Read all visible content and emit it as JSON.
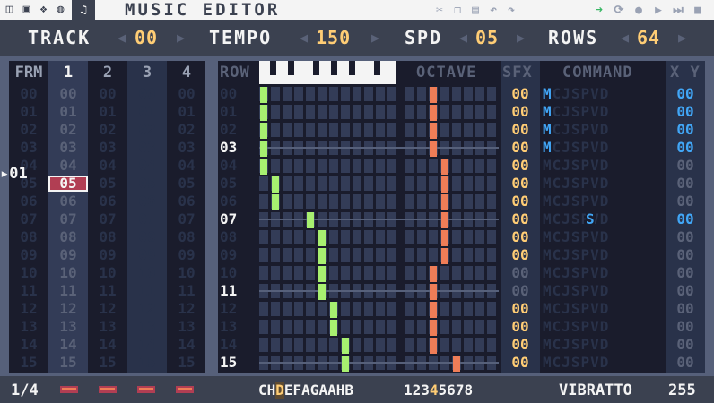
{
  "app_title": "MUSIC EDITOR",
  "menu_icons": [
    "code-icon",
    "sprite-icon",
    "map-icon",
    "sfx-icon",
    "music-icon"
  ],
  "toolbar_icons": [
    "cut-icon",
    "copy-icon",
    "paste-icon",
    "undo-icon",
    "redo-icon"
  ],
  "right_icons": [
    "follow-icon",
    "loop-icon",
    "record-icon",
    "play-icon",
    "stop-icon"
  ],
  "header": {
    "track_label": "TRACK",
    "track_value": "00",
    "tempo_label": "TEMPO",
    "tempo_value": "150",
    "spd_label": "SPD",
    "spd_value": "05",
    "rows_label": "ROWS",
    "rows_value": "64"
  },
  "frames": {
    "header": "FRM",
    "channels": [
      "1",
      "2",
      "3",
      "4"
    ],
    "active_channel": 0,
    "rows": [
      "00",
      "01",
      "02",
      "03",
      "04",
      "05",
      "06",
      "07",
      "08",
      "09",
      "10",
      "11",
      "12",
      "13",
      "14",
      "15"
    ],
    "current_frame": "01",
    "selected": {
      "row": 5,
      "value": "05"
    }
  },
  "pattern": {
    "row_header": "ROW",
    "octave_header": "OCTAVE",
    "sfx_header": "SFX",
    "command_header": "COMMAND",
    "xy_header": "X Y",
    "rows": [
      "00",
      "01",
      "02",
      "03",
      "04",
      "05",
      "06",
      "07",
      "08",
      "09",
      "10",
      "11",
      "12",
      "13",
      "14",
      "15"
    ],
    "highlight_rows": [
      3,
      7,
      11,
      15
    ],
    "note_positions": [
      0,
      0,
      0,
      0,
      0,
      1,
      1,
      4,
      5,
      5,
      5,
      5,
      6,
      6,
      7,
      7
    ],
    "octave_positions": [
      0,
      0,
      0,
      0,
      1,
      1,
      1,
      1,
      1,
      1,
      0,
      0,
      0,
      0,
      0,
      2
    ],
    "sfx": [
      "00",
      "00",
      "00",
      "00",
      "00",
      "00",
      "00",
      "00",
      "00",
      "00",
      "00",
      "00",
      "00",
      "00",
      "00",
      "00"
    ],
    "sfx_active": [
      true,
      true,
      true,
      true,
      true,
      true,
      true,
      true,
      true,
      true,
      false,
      false,
      true,
      true,
      true,
      true
    ],
    "command_string": "MCJSPVD",
    "commands": {
      "0": "M",
      "1": "M",
      "2": "M",
      "3": "M",
      "7": "S"
    },
    "xy": [
      "00",
      "00",
      "00",
      "00",
      "00",
      "00",
      "00",
      "00",
      "00",
      "00",
      "00",
      "00",
      "00",
      "00",
      "00",
      "00"
    ],
    "xy_active": [
      true,
      true,
      true,
      true,
      false,
      false,
      false,
      true,
      false,
      false,
      false,
      false,
      false,
      false,
      false,
      false
    ]
  },
  "footer": {
    "page": "1/4",
    "notes_prefix": "C",
    "notes_highlight": "D",
    "notes_suffix": "EFAGAAHB",
    "octaves_prefix": "123",
    "octaves_highlight": "4",
    "octaves_suffix": "5678",
    "notes_lead": "CH",
    "command_name": "VIBRATTO",
    "command_value": "255"
  }
}
